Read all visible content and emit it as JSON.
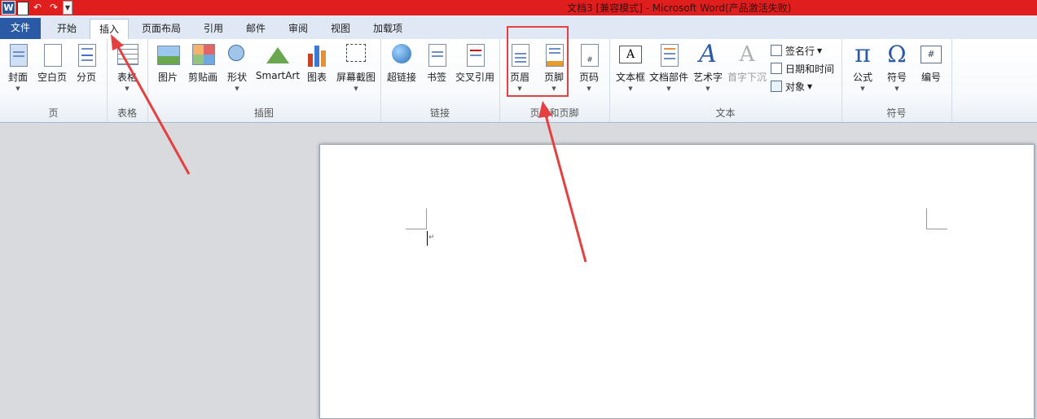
{
  "window": {
    "title": "文档3 [兼容模式] - Microsoft Word(产品激活失败)",
    "app_logo": "W"
  },
  "tabs": [
    {
      "label": "文件"
    },
    {
      "label": "开始"
    },
    {
      "label": "插入"
    },
    {
      "label": "页面布局"
    },
    {
      "label": "引用"
    },
    {
      "label": "邮件"
    },
    {
      "label": "审阅"
    },
    {
      "label": "视图"
    },
    {
      "label": "加载项"
    }
  ],
  "active_tab": "插入",
  "ribbon": {
    "groups": {
      "page": {
        "label": "页",
        "buttons": [
          "封面",
          "空白页",
          "分页"
        ]
      },
      "table": {
        "label": "表格",
        "buttons": [
          "表格"
        ]
      },
      "illustrations": {
        "label": "插图",
        "buttons": [
          "图片",
          "剪贴画",
          "形状",
          "SmartArt",
          "图表",
          "屏幕截图"
        ]
      },
      "links": {
        "label": "链接",
        "buttons": [
          "超链接",
          "书签",
          "交叉引用"
        ]
      },
      "header_footer": {
        "label": "页眉和页脚",
        "buttons": [
          "页眉",
          "页脚",
          "页码"
        ]
      },
      "text": {
        "label": "文本",
        "buttons": [
          "文本框",
          "文档部件",
          "艺术字",
          "首字下沉"
        ],
        "small_buttons": [
          "签名行",
          "日期和时间",
          "对象"
        ]
      },
      "symbols": {
        "label": "符号",
        "buttons": [
          "公式",
          "符号",
          "编号"
        ]
      }
    }
  },
  "icons": {
    "equation_glyph": "π",
    "symbol_glyph": "Ω",
    "wordart_glyph": "A",
    "textbox_glyph": "A",
    "dropcap_glyph": "A",
    "number_glyph": "#"
  },
  "colors": {
    "title_bar": "#e01e1e",
    "file_tab": "#2a5aa5",
    "annotation": "#e53f3f"
  }
}
